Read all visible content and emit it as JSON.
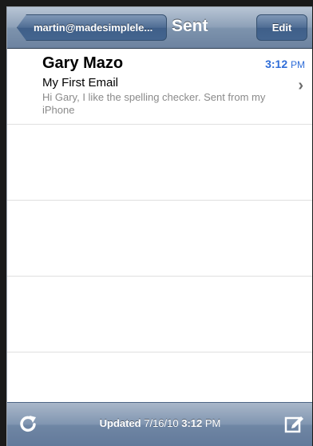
{
  "navbar": {
    "back_label": "martin@madesimplele...",
    "title": "Sent",
    "edit_label": "Edit"
  },
  "messages": [
    {
      "sender": "Gary Mazo",
      "time": "3:12",
      "ampm": "PM",
      "subject": "My First Email",
      "preview": "Hi Gary, I like the spelling checker. Sent from my iPhone"
    }
  ],
  "toolbar": {
    "updated_label": "Updated",
    "updated_date": "7/16/10",
    "updated_time": "3:12",
    "updated_ampm": "PM",
    "refresh_icon": "refresh-icon",
    "compose_icon": "compose-icon"
  },
  "colors": {
    "accent_time": "#2f6dd8",
    "navbar": "#7d93ad"
  }
}
